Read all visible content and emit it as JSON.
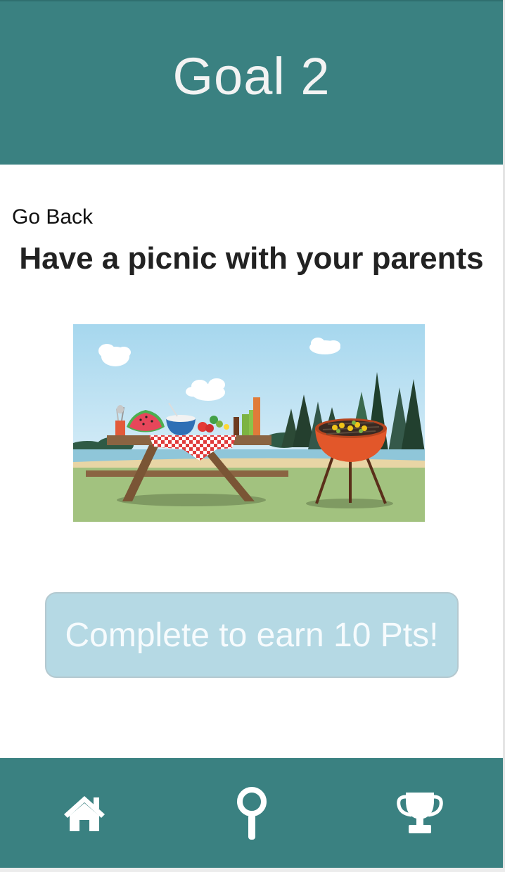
{
  "header": {
    "title": "Goal 2"
  },
  "nav": {
    "go_back_label": "Go Back"
  },
  "goal": {
    "title": "Have a picnic with your parents"
  },
  "action": {
    "complete_label": "Complete to earn 10 Pts!"
  },
  "bottom_nav": {
    "items": [
      {
        "icon": "home-icon"
      },
      {
        "icon": "search-icon"
      },
      {
        "icon": "trophy-icon"
      }
    ]
  },
  "colors": {
    "header_bg": "#3a8181",
    "button_bg": "#b5d9e4",
    "button_text": "#f6fbfd",
    "icon_color": "#ffffff"
  }
}
